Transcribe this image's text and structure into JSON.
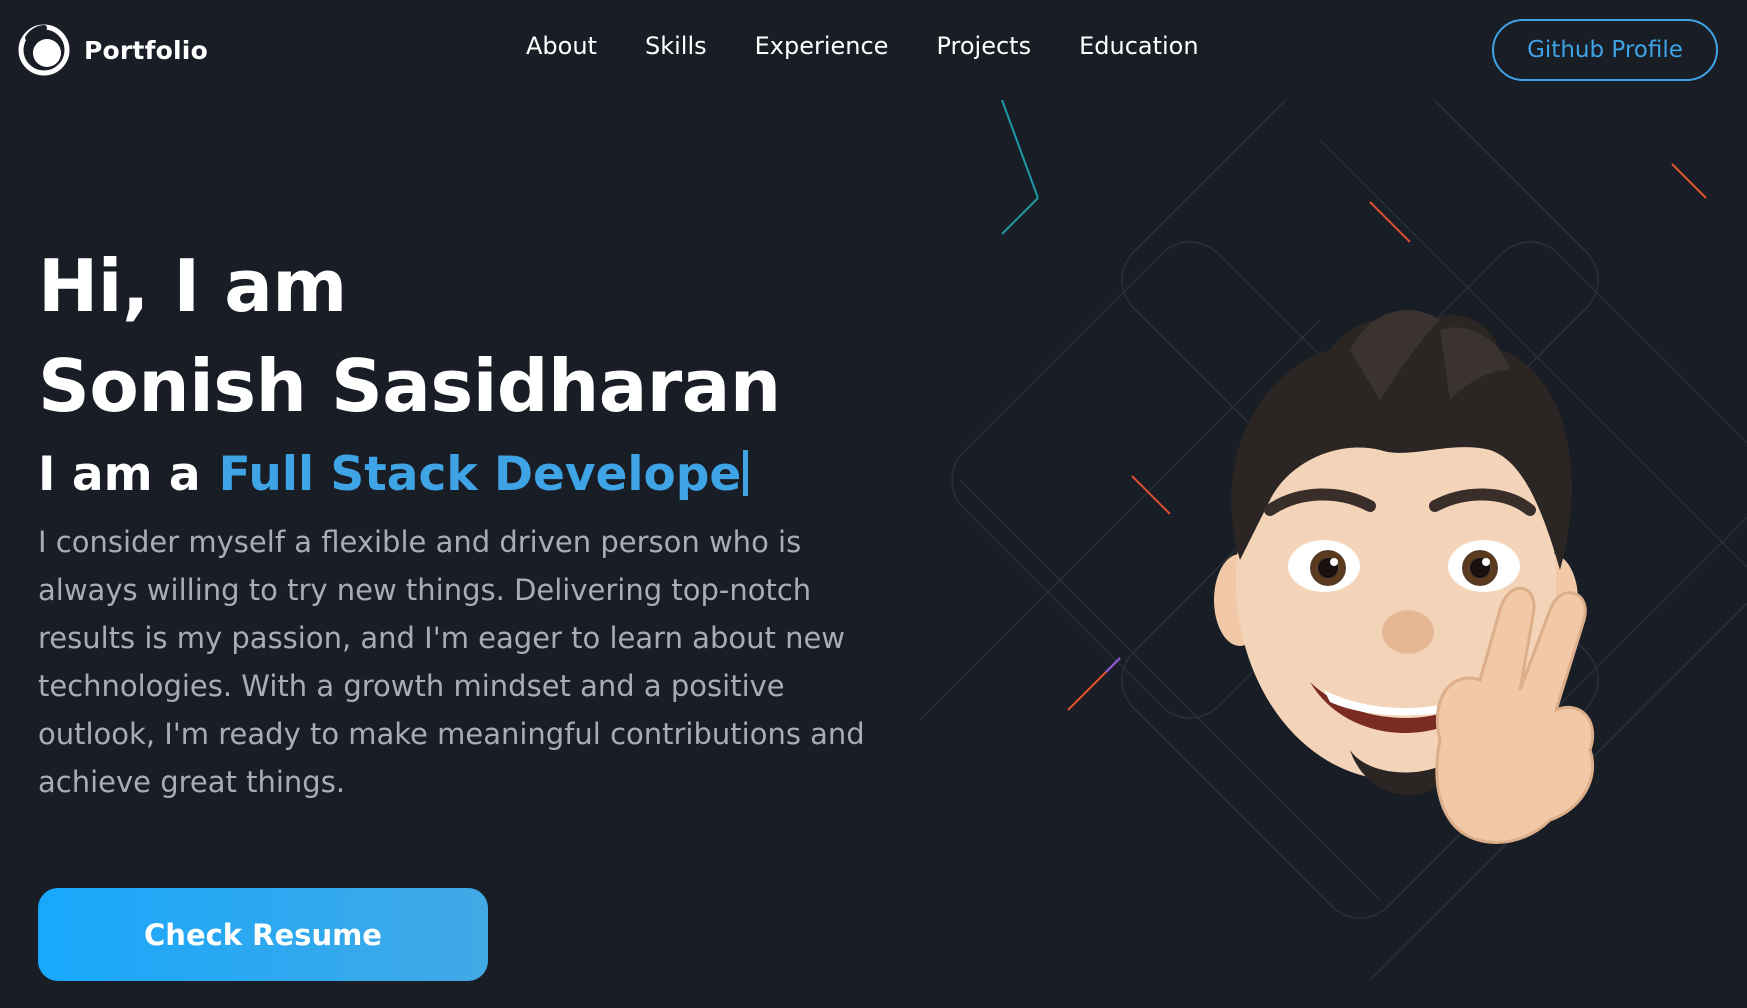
{
  "navbar": {
    "brand_text": "Portfolio",
    "links": [
      {
        "label": "About"
      },
      {
        "label": "Skills"
      },
      {
        "label": "Experience"
      },
      {
        "label": "Projects"
      },
      {
        "label": "Education"
      }
    ],
    "github_label": "Github Profile"
  },
  "hero": {
    "greeting": "Hi, I am",
    "name": "Sonish Sasidharan",
    "role_prefix": "I am a",
    "role_typed": "Full Stack Develope",
    "bio": "I consider myself a flexible and driven person who is always willing to try new things. Delivering top-notch results is my passion, and I'm eager to learn about new technologies. With a growth mindset and a positive outlook, I'm ready to make meaningful contributions and achieve great things.",
    "resume_label": "Check Resume"
  },
  "icons": {
    "logo": "portfolio-logo-icon",
    "avatar": "memoji-avatar-peace-sign"
  },
  "colors": {
    "background": "#191d25",
    "accent": "#3fa4e6",
    "text": "#ffffff",
    "muted_text": "#a7adb8",
    "button_gradient_start": "#18a8fb",
    "button_gradient_end": "#41a9e6"
  }
}
